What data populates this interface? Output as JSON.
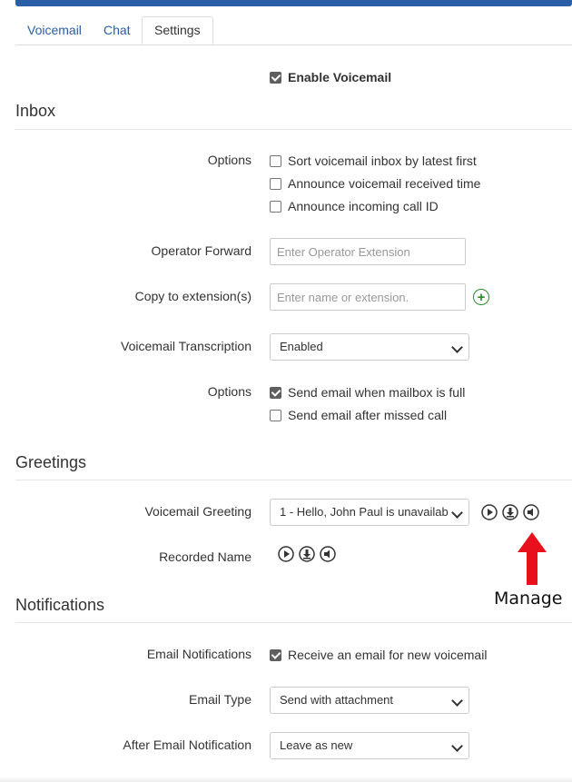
{
  "tabs": [
    {
      "label": "Voicemail",
      "active": false
    },
    {
      "label": "Chat",
      "active": false
    },
    {
      "label": "Settings",
      "active": true
    }
  ],
  "enable_voicemail": {
    "label": "Enable Voicemail",
    "checked": true
  },
  "inbox": {
    "title": "Inbox",
    "options_label": "Options",
    "options": [
      {
        "label": "Sort voicemail inbox by latest first",
        "checked": false
      },
      {
        "label": "Announce voicemail received time",
        "checked": false
      },
      {
        "label": "Announce incoming call ID",
        "checked": false
      }
    ],
    "operator_forward": {
      "label": "Operator Forward",
      "placeholder": "Enter Operator Extension",
      "value": ""
    },
    "copy_to": {
      "label": "Copy to extension(s)",
      "placeholder": "Enter name or extension.",
      "value": "",
      "add_icon": "plus-circle-icon"
    },
    "transcription": {
      "label": "Voicemail Transcription",
      "value": "Enabled"
    },
    "options2_label": "Options",
    "options2": [
      {
        "label": "Send email when mailbox is full",
        "checked": true
      },
      {
        "label": "Send email after missed call",
        "checked": false
      }
    ]
  },
  "greetings": {
    "title": "Greetings",
    "voicemail_greeting": {
      "label": "Voicemail Greeting",
      "value": "1 - Hello, John Paul is unavailab"
    },
    "recorded_name": {
      "label": "Recorded Name"
    },
    "icons": [
      "play-icon",
      "download-icon",
      "speaker-icon"
    ]
  },
  "annotation": {
    "text": "Manage",
    "color": "#e8101c"
  },
  "notifications": {
    "title": "Notifications",
    "email_notifications": {
      "label": "Email Notifications",
      "option": "Receive an email for new voicemail",
      "checked": true
    },
    "email_type": {
      "label": "Email Type",
      "value": "Send with attachment"
    },
    "after_email": {
      "label": "After Email Notification",
      "value": "Leave as new"
    }
  },
  "colors": {
    "accent": "#2a5ea7",
    "add_green": "#2f8a2f",
    "checkbox": "#5f5f5f"
  }
}
